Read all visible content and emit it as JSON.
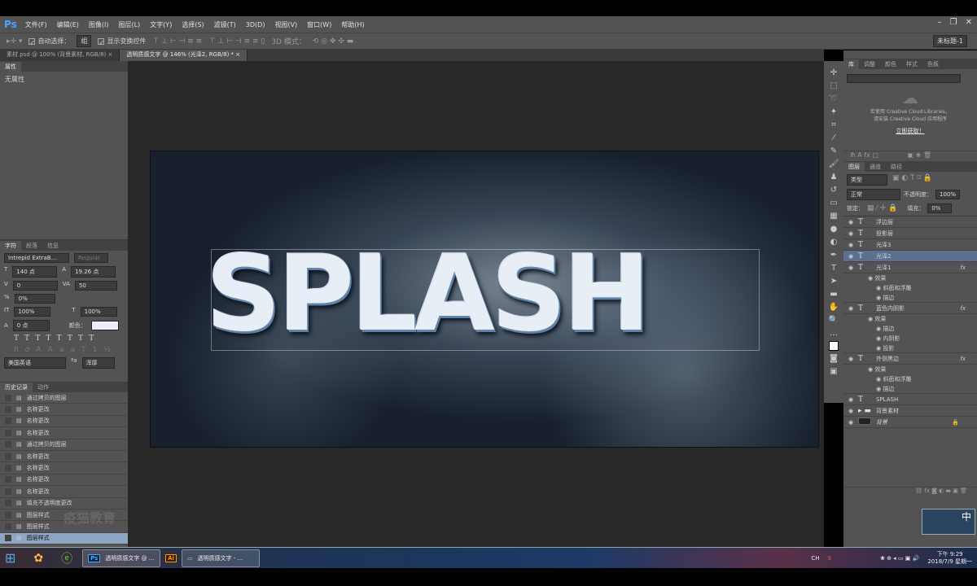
{
  "app": {
    "logo": "Ps",
    "menu": [
      "文件(F)",
      "编辑(E)",
      "图像(I)",
      "图层(L)",
      "文字(Y)",
      "选择(S)",
      "滤镜(T)",
      "3D(D)",
      "视图(V)",
      "窗口(W)",
      "帮助(H)"
    ],
    "window_controls": [
      "–",
      "❐",
      "✕"
    ]
  },
  "options": {
    "auto_select_label": "自动选择：",
    "auto_select_value": "组",
    "show_transform_label": "显示变换控件",
    "mode3d_label": "3D 模式：",
    "workspace": "未标题-1"
  },
  "tabs": [
    {
      "label": "素材.psd @ 100% (背景素材, RGB/8)",
      "close": "×"
    },
    {
      "label": "透明质感文字 @ 146% (光泽2, RGB/8) *",
      "close": "×"
    }
  ],
  "properties": {
    "tab": "属性",
    "content": "无属性"
  },
  "character": {
    "tabs": [
      "字符",
      "段落",
      "信息"
    ],
    "font": "Intrepid ExtraB...",
    "style": "Regular",
    "size": "140 点",
    "leading": "19.26 点",
    "kerning": "0",
    "tracking": "50",
    "tsume": "0%",
    "vscale": "100%",
    "hscale": "100%",
    "baseline": "0 点",
    "color_label": "颜色：",
    "color": "#e8eef4",
    "language": "美国英语",
    "aa": "浑厚"
  },
  "history": {
    "tabs": [
      "历史记录",
      "动作"
    ],
    "items": [
      "通过拷贝的图层",
      "名称更改",
      "名称更改",
      "名称更改",
      "通过拷贝的图层",
      "名称更改",
      "名称更改",
      "名称更改",
      "名称更改",
      "填充不透明度更改",
      "图层样式",
      "图层样式",
      "图层样式"
    ]
  },
  "watermark": "疫猫教育",
  "canvas": {
    "text": "SPLASH"
  },
  "library": {
    "tabs": [
      "库",
      "调整",
      "颜色",
      "样式",
      "色板"
    ],
    "msg1": "若使用 Creative Cloud Libraries，",
    "msg2": "请安装 Creative Cloud 应用程序",
    "link": "立即获取！"
  },
  "layers": {
    "tabs": [
      "图层",
      "通道",
      "路径"
    ],
    "filter": "类型",
    "blend": "正常",
    "opacity_label": "不透明度：",
    "opacity": "100%",
    "lock_label": "锁定：",
    "fill_label": "填充：",
    "fill": "0%",
    "items": [
      {
        "name": "浮边层",
        "type": "T"
      },
      {
        "name": "投影层",
        "type": "T"
      },
      {
        "name": "光泽3",
        "type": "T"
      },
      {
        "name": "光泽2",
        "type": "T",
        "selected": true
      },
      {
        "name": "光泽1",
        "type": "T",
        "fx": "fx",
        "effects_label": "效果",
        "effects": [
          "斜面和浮雕",
          "描边"
        ]
      },
      {
        "name": "蓝色内阴影",
        "type": "T",
        "fx": "fx",
        "effects_label": "效果",
        "effects": [
          "描边",
          "内阴影",
          "投影"
        ]
      },
      {
        "name": "外侧黑边",
        "type": "T",
        "fx": "fx",
        "effects_label": "效果",
        "effects": [
          "斜面和浮雕",
          "描边"
        ]
      },
      {
        "name": "SPLASH",
        "type": "T"
      },
      {
        "name": "背景素材",
        "type": "folder"
      },
      {
        "name": "背景",
        "type": "image",
        "locked": true
      }
    ]
  },
  "taskbar": {
    "buttons": [
      "透明质感文字 @ ...",
      "透明质感文字 - ..."
    ],
    "time": "下午 9:29",
    "date": "2018/7/9 星期一",
    "ime": "中",
    "tray_lang": "CH"
  },
  "colors": {
    "accent": "#4aa3ff",
    "panel": "#535353",
    "selected": "#5b6f8f"
  }
}
